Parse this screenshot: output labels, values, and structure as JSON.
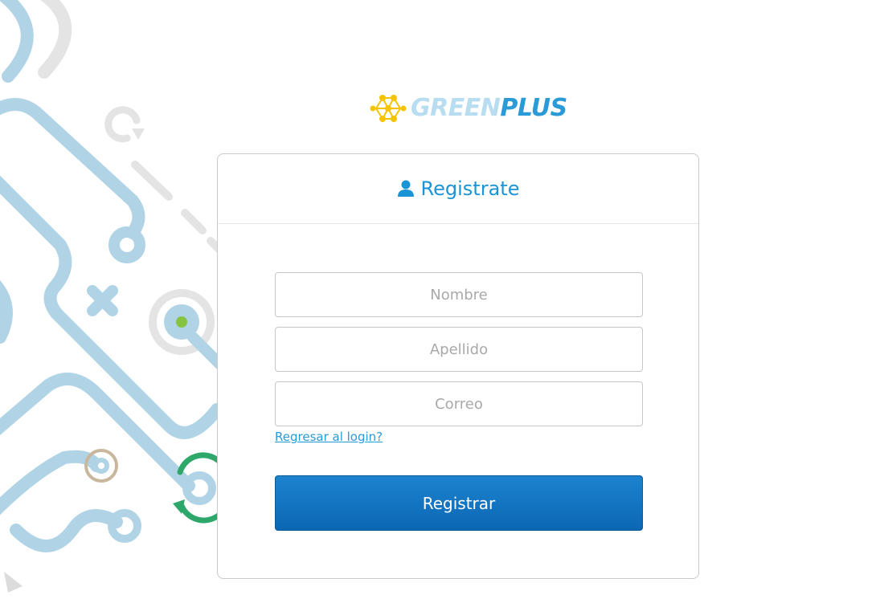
{
  "brand": {
    "part1": "GREEN",
    "part2": "PLUS"
  },
  "card": {
    "title": "Registrate"
  },
  "form": {
    "nombre_placeholder": "Nombre",
    "apellido_placeholder": "Apellido",
    "correo_placeholder": "Correo",
    "back_link": "Regresar al login?",
    "submit_label": "Registrar"
  },
  "icons": {
    "brand": "greenplus-logo-icon",
    "title": "user-icon"
  },
  "colors": {
    "accent": "#1a94d6",
    "button_top": "#1d83cf",
    "button_bottom": "#0b67b4",
    "logo_yellow": "#f5c400",
    "decor_blue": "#b0d4e6",
    "decor_gray": "#e4e4e4",
    "decor_green": "#2ea86a"
  }
}
